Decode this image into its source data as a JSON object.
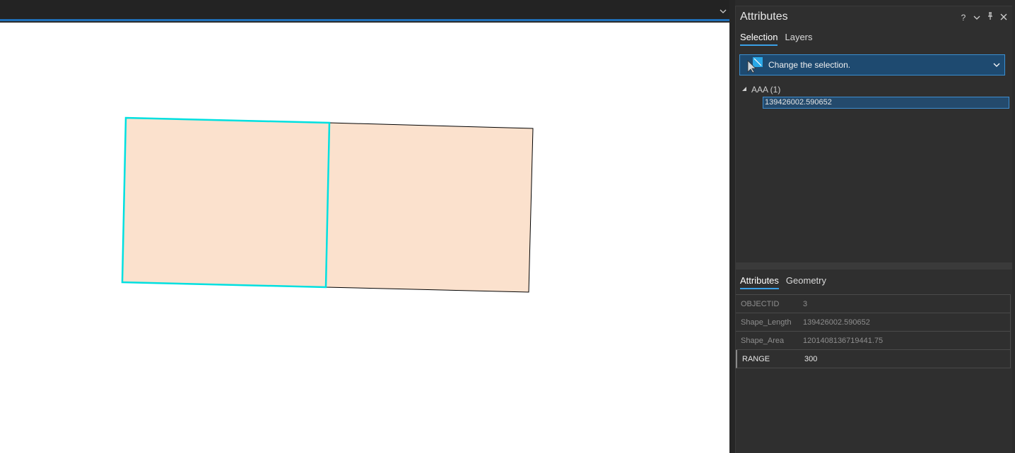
{
  "pane": {
    "title": "Attributes",
    "controls": {
      "help": "?",
      "menu_icon": "chevron-down-icon",
      "pin_icon": "pin-icon",
      "close_icon": "close-icon"
    },
    "tabs": [
      {
        "label": "Selection",
        "active": true
      },
      {
        "label": "Layers",
        "active": false
      }
    ],
    "selection_dropdown": {
      "label": "Change the selection.",
      "icon": "select-tool-icon"
    },
    "tree": {
      "layer": "AAA (1)",
      "items": [
        "139426002.590652"
      ]
    },
    "detail_tabs": [
      {
        "label": "Attributes",
        "active": true
      },
      {
        "label": "Geometry",
        "active": false
      }
    ],
    "attributes": [
      {
        "field": "OBJECTID",
        "value": "3",
        "editable": false
      },
      {
        "field": "Shape_Length",
        "value": "139426002.590652",
        "editable": false
      },
      {
        "field": "Shape_Area",
        "value": "1201408136719441.75",
        "editable": false
      },
      {
        "field": "RANGE",
        "value": "300",
        "editable": true
      }
    ]
  },
  "map": {
    "feature_fill": "#fbe1cd",
    "selection_color": "#00e0e0",
    "outline_color": "#000000"
  },
  "colors": {
    "accent": "#3aa0e6",
    "dropdown_bg": "#1e4a70"
  }
}
